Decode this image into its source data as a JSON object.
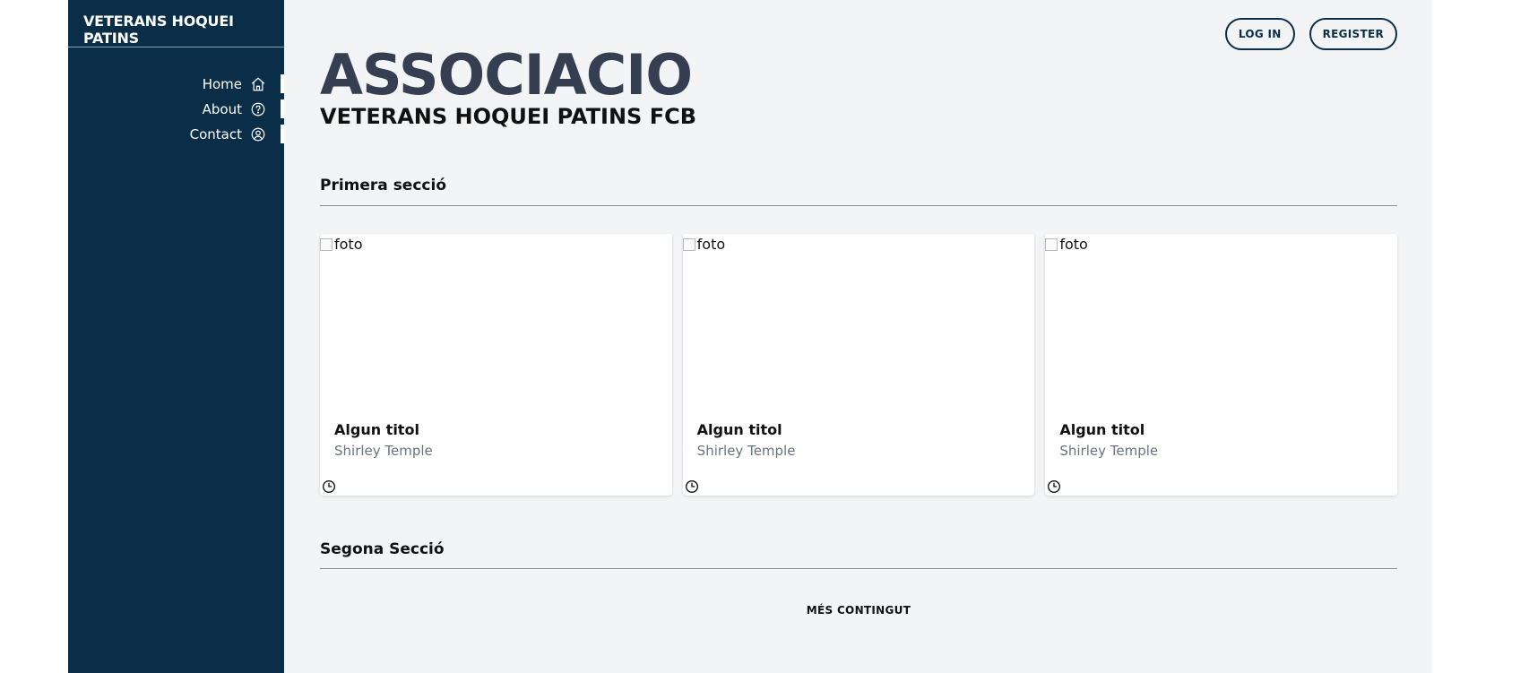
{
  "sidebar": {
    "brand": "VETERANS HOQUEI PATINS",
    "items": [
      {
        "label": "Home",
        "icon": "home-icon"
      },
      {
        "label": "About",
        "icon": "help-circle-icon"
      },
      {
        "label": "Contact",
        "icon": "user-circle-icon"
      }
    ]
  },
  "header": {
    "login_label": "LOG IN",
    "register_label": "REGISTER",
    "title": "ASSOCIACIO",
    "subtitle": "VETERANS HOQUEI PATINS FCB"
  },
  "sections": {
    "first_title": "Primera secció",
    "second_title": "Segona Secció",
    "more_label": "MÉS CONTINGUT"
  },
  "cards": [
    {
      "image_alt": "foto",
      "title": "Algun titol",
      "author": "Shirley Temple",
      "icon": "clock-icon"
    },
    {
      "image_alt": "foto",
      "title": "Algun titol",
      "author": "Shirley Temple",
      "icon": "clock-icon"
    },
    {
      "image_alt": "foto",
      "title": "Algun titol",
      "author": "Shirley Temple",
      "icon": "clock-icon"
    }
  ],
  "colors": {
    "sidebar_bg": "#0a2e48",
    "main_bg": "#f3f4f6",
    "title": "#363f52",
    "author": "#6b7280"
  }
}
